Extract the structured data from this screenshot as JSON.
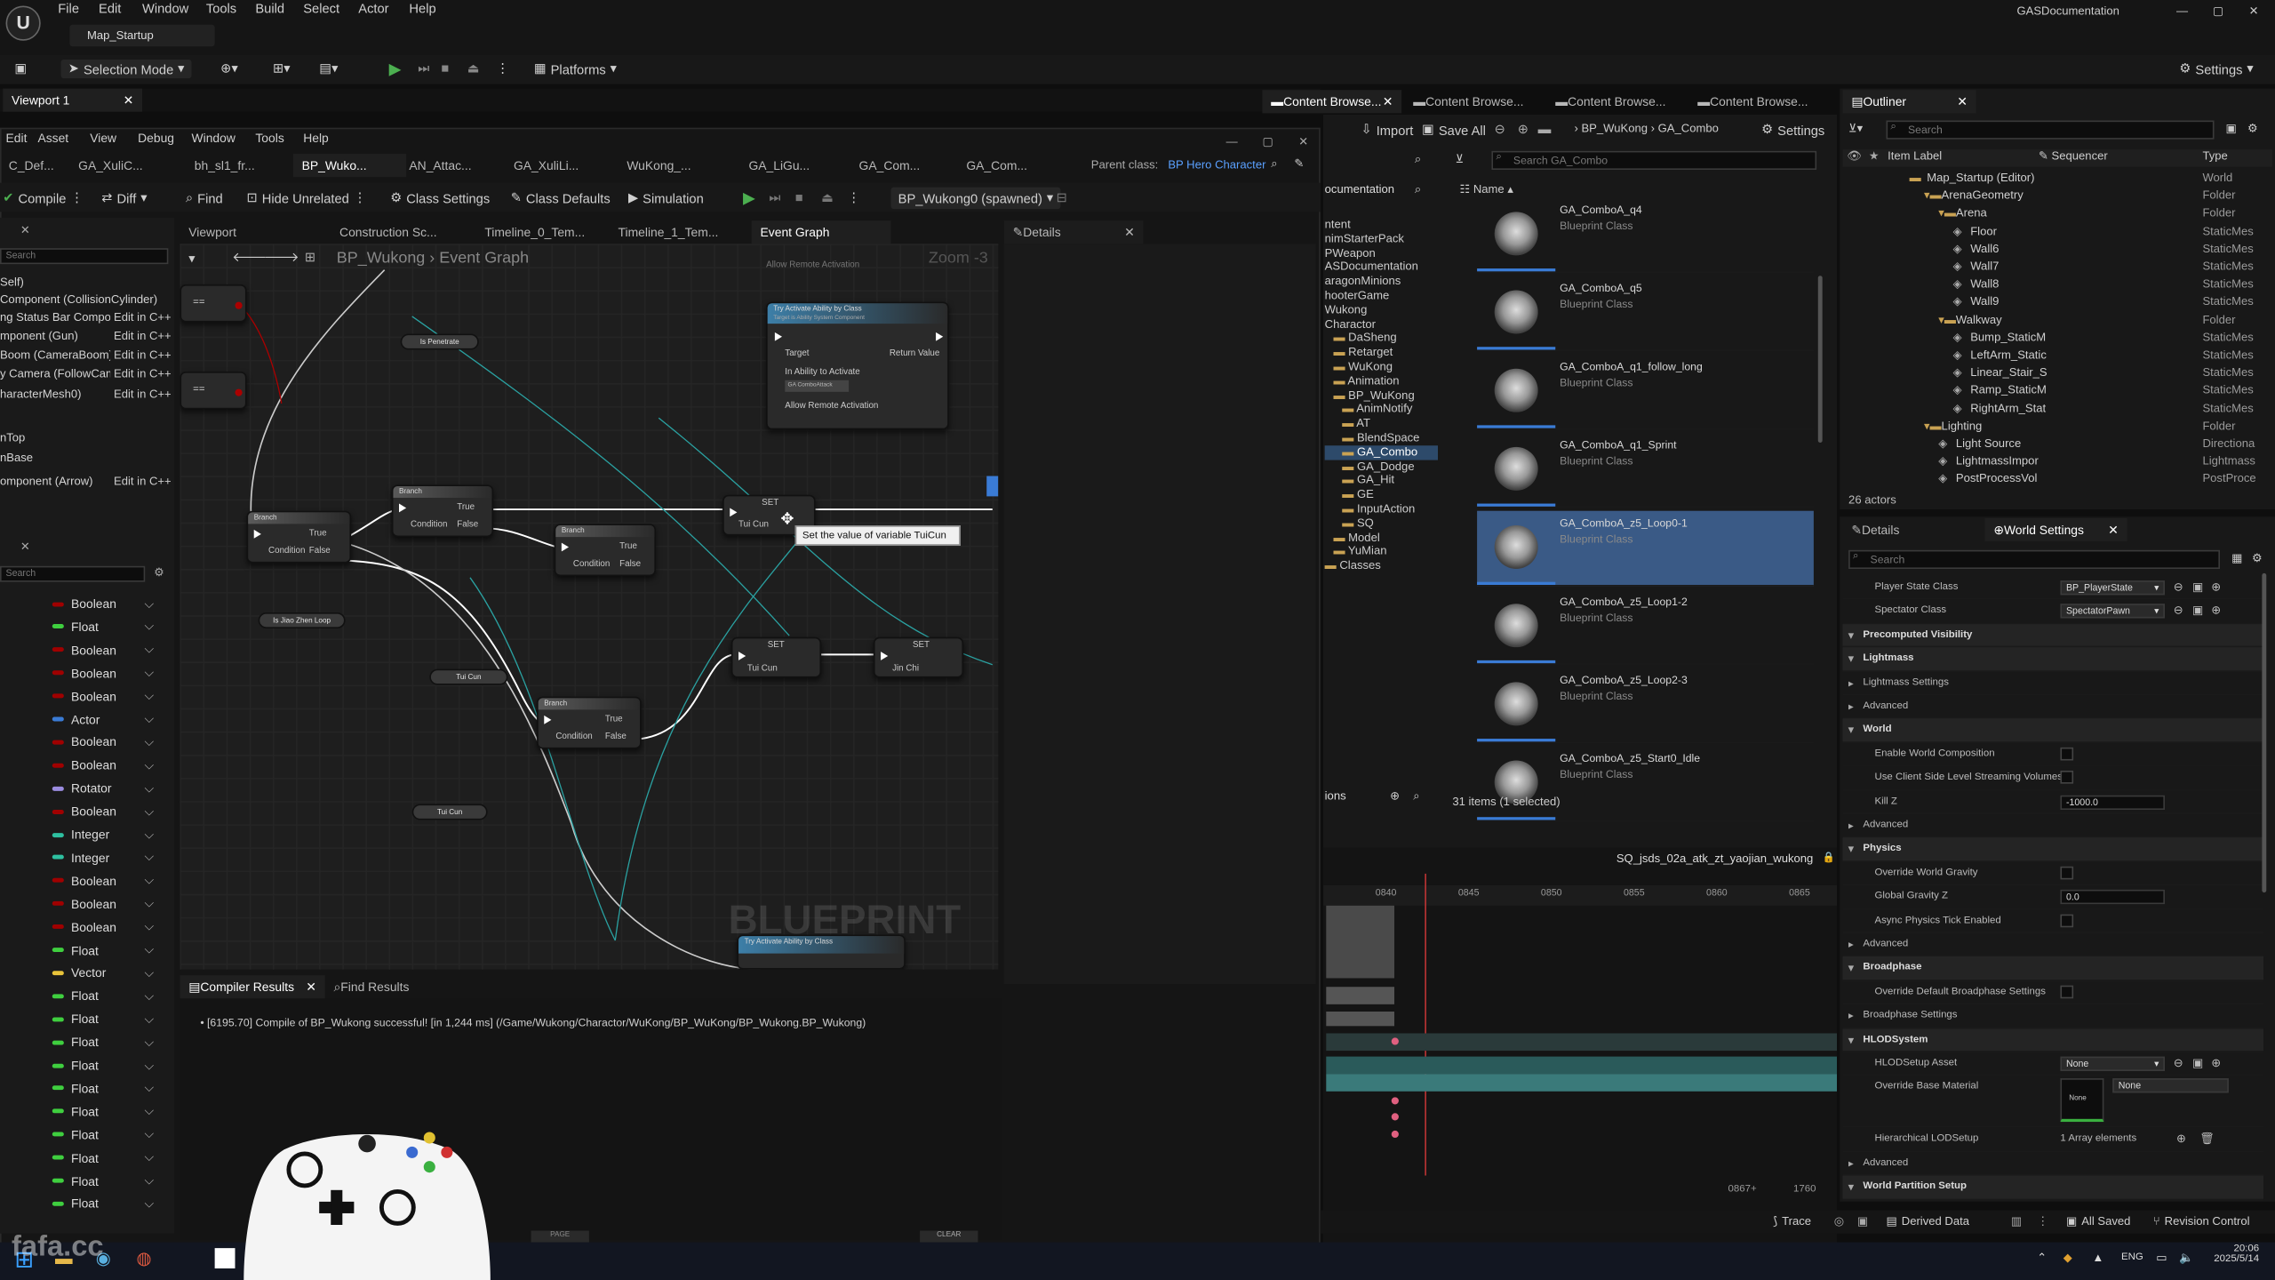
{
  "app": {
    "title": "GASDocumentation",
    "map_tab": "Map_Startup",
    "window_controls": [
      "—",
      "▢",
      "✕"
    ]
  },
  "menubar": [
    "File",
    "Edit",
    "Window",
    "Tools",
    "Build",
    "Select",
    "Actor",
    "Help"
  ],
  "main_toolbar": {
    "selection_mode": "Selection Mode",
    "platforms": "Platforms",
    "settings": "Settings"
  },
  "viewport_tab": "Viewport 1",
  "bp_editor": {
    "menubar": [
      "Edit",
      "Asset",
      "View",
      "Debug",
      "Window",
      "Tools",
      "Help"
    ],
    "asset_tabs": [
      "C_Def...",
      "GA_XuliC...",
      "bh_sl1_fr...",
      "BP_Wuko...",
      "AN_Attac...",
      "GA_XuliLi...",
      "WuKong_...",
      "GA_LiGu...",
      "GA_Com...",
      "GA_Com..."
    ],
    "parent_class_label": "Parent class:",
    "parent_class_value": "BP Hero Character",
    "toolbar": {
      "compile": "Compile",
      "diff": "Diff",
      "find": "Find",
      "hide_unrelated": "Hide Unrelated",
      "class_settings": "Class Settings",
      "class_defaults": "Class Defaults",
      "simulation": "Simulation",
      "debug_object": "BP_Wukong0 (spawned)"
    },
    "panel_tabs": [
      "Viewport",
      "Construction Sc...",
      "Timeline_0_Tem...",
      "Timeline_1_Tem...",
      "Event Graph"
    ],
    "details_tab": "Details",
    "breadcrumb": [
      "BP_Wukong",
      "Event Graph"
    ],
    "zoom": "Zoom -3",
    "watermark": "BLUEPRINT",
    "search_placeholder": "Search",
    "components": [
      "Self)",
      "Component (CollisionCylinder)",
      "ng Status Bar Component (UI)",
      "mponent (Gun)",
      "Boom (CameraBoom)",
      "y Camera (FollowCamera)",
      "haracterMesh0)",
      "nTop",
      "nBase",
      "omponent (Arrow)"
    ],
    "edit_in_cpp": "Edit in C++",
    "variables": [
      {
        "type": "Boolean",
        "color": "#a00000"
      },
      {
        "type": "Float",
        "color": "#3fcf3f"
      },
      {
        "type": "Boolean",
        "color": "#a00000"
      },
      {
        "type": "Boolean",
        "color": "#a00000"
      },
      {
        "type": "Boolean",
        "color": "#a00000"
      },
      {
        "type": "Actor",
        "color": "#3a7bd5"
      },
      {
        "type": "Boolean",
        "color": "#a00000"
      },
      {
        "type": "Boolean",
        "color": "#a00000"
      },
      {
        "type": "Rotator",
        "color": "#9b8ce0"
      },
      {
        "type": "Boolean",
        "color": "#a00000"
      },
      {
        "type": "Integer",
        "color": "#2ec0a0"
      },
      {
        "type": "Integer",
        "color": "#2ec0a0"
      },
      {
        "type": "Boolean",
        "color": "#a00000"
      },
      {
        "type": "Boolean",
        "color": "#a00000"
      },
      {
        "type": "Boolean",
        "color": "#a00000"
      },
      {
        "type": "Float",
        "color": "#3fcf3f"
      },
      {
        "type": "Vector",
        "color": "#e8c33a"
      },
      {
        "type": "Float",
        "color": "#3fcf3f"
      },
      {
        "type": "Float",
        "color": "#3fcf3f"
      },
      {
        "type": "Float",
        "color": "#3fcf3f"
      },
      {
        "type": "Float",
        "color": "#3fcf3f"
      },
      {
        "type": "Float",
        "color": "#3fcf3f"
      },
      {
        "type": "Float",
        "color": "#3fcf3f"
      },
      {
        "type": "Float",
        "color": "#3fcf3f"
      },
      {
        "type": "Float",
        "color": "#3fcf3f"
      },
      {
        "type": "Float",
        "color": "#3fcf3f"
      },
      {
        "type": "Float",
        "color": "#3fcf3f"
      }
    ],
    "graph": {
      "nodes": {
        "try_activate": "Try Activate Ability by Class",
        "target_comp": "Target is Ability System Component",
        "target": "Target",
        "return_value": "Return Value",
        "in_ability": "In Ability to Activate",
        "ability_val": "GA ComboAttack",
        "allow_remote": "Allow Remote Activation",
        "branch": "Branch",
        "true": "True",
        "false": "False",
        "condition": "Condition",
        "set": "SET",
        "is_penetrate": "Is Penetrate",
        "is_jiao": "Is Jiao Zhen Loop",
        "tuicun": "Tui Cun",
        "jinchi": "Jin Chi",
        "eq": "=="
      },
      "tooltip": "Set the value of variable TuiCun"
    },
    "compiler_tab": "Compiler Results",
    "find_results_tab": "Find Results",
    "compile_log": "[6195.70] Compile of BP_Wukong successful! [in 1,244 ms] (/Game/Wukong/Charactor/WuKong/BP_WuKong/BP_Wukong.BP_Wukong)",
    "clear_label": "CLEAR",
    "page_label": "PAGE"
  },
  "content_browser": {
    "tabs": [
      "Content Browse...",
      "Content Browse...",
      "Content Browse...",
      "Content Browse..."
    ],
    "toolbar": {
      "import": "Import",
      "save_all": "Save All",
      "settings": "Settings"
    },
    "path": [
      "BP_WuKong",
      "GA_Combo"
    ],
    "search_placeholder": "Search GA_Combo",
    "name_col": "Name",
    "tree_header": "ocumentation",
    "tree": [
      "ntent",
      "nimStarterPack",
      "PWeapon",
      "ASDocumentation",
      "aragonMinions",
      "hooterGame",
      "Wukong",
      "Charactor",
      "DaSheng",
      "Retarget",
      "WuKong",
      "Animation",
      "BP_WuKong",
      "AnimNotify",
      "AT",
      "BlendSpace",
      "GA_Combo",
      "GA_Dodge",
      "GA_Hit",
      "GE",
      "InputAction",
      "SQ",
      "Model",
      "YuMian",
      "Classes"
    ],
    "assets": [
      {
        "name": "GA_ComboA_q4",
        "cls": "Blueprint Class"
      },
      {
        "name": "GA_ComboA_q5",
        "cls": "Blueprint Class"
      },
      {
        "name": "GA_ComboA_q1_follow_long",
        "cls": "Blueprint Class"
      },
      {
        "name": "GA_ComboA_q1_Sprint",
        "cls": "Blueprint Class"
      },
      {
        "name": "GA_ComboA_z5_Loop0-1",
        "cls": "Blueprint Class"
      },
      {
        "name": "GA_ComboA_z5_Loop1-2",
        "cls": "Blueprint Class"
      },
      {
        "name": "GA_ComboA_z5_Loop2-3",
        "cls": "Blueprint Class"
      },
      {
        "name": "GA_ComboA_z5_Start0_Idle",
        "cls": "Blueprint Class"
      }
    ],
    "status": "31 items (1 selected)",
    "collections": "ions"
  },
  "sequencer": {
    "title": "SQ_jsds_02a_atk_zt_yaojian_wukong",
    "ticks": [
      "0840",
      "0845",
      "0850",
      "0855",
      "0860",
      "0865"
    ],
    "frame": "0867+",
    "end": "1760"
  },
  "outliner": {
    "tab": "Outliner",
    "search_placeholder": "Search",
    "col_label": "Item Label",
    "col_seq": "Sequencer",
    "col_type": "Type",
    "rows": [
      {
        "l": "Map_Startup (Editor)",
        "t": "World",
        "d": 0
      },
      {
        "l": "ArenaGeometry",
        "t": "Folder",
        "d": 1
      },
      {
        "l": "Arena",
        "t": "Folder",
        "d": 2
      },
      {
        "l": "Floor",
        "t": "StaticMes",
        "d": 3
      },
      {
        "l": "Wall6",
        "t": "StaticMes",
        "d": 3
      },
      {
        "l": "Wall7",
        "t": "StaticMes",
        "d": 3
      },
      {
        "l": "Wall8",
        "t": "StaticMes",
        "d": 3
      },
      {
        "l": "Wall9",
        "t": "StaticMes",
        "d": 3
      },
      {
        "l": "Walkway",
        "t": "Folder",
        "d": 2
      },
      {
        "l": "Bump_StaticM",
        "t": "StaticMes",
        "d": 3
      },
      {
        "l": "LeftArm_Static",
        "t": "StaticMes",
        "d": 3
      },
      {
        "l": "Linear_Stair_S",
        "t": "StaticMes",
        "d": 3
      },
      {
        "l": "Ramp_StaticM",
        "t": "StaticMes",
        "d": 3
      },
      {
        "l": "RightArm_Stat",
        "t": "StaticMes",
        "d": 3
      },
      {
        "l": "Lighting",
        "t": "Folder",
        "d": 1
      },
      {
        "l": "Light Source",
        "t": "Directiona",
        "d": 2
      },
      {
        "l": "LightmassImpor",
        "t": "Lightmass",
        "d": 2
      },
      {
        "l": "PostProcessVol",
        "t": "PostProce",
        "d": 2
      }
    ],
    "count": "26 actors"
  },
  "details": {
    "tab_details": "Details",
    "tab_world": "World Settings",
    "search_placeholder": "Search",
    "rows": [
      {
        "k": "Player State Class",
        "v": "BP_PlayerState",
        "kind": "combo"
      },
      {
        "k": "Spectator Class",
        "v": "SpectatorPawn",
        "kind": "combo"
      },
      {
        "k": "Precomputed Visibility",
        "kind": "section"
      },
      {
        "k": "Lightmass",
        "kind": "section"
      },
      {
        "k": "Lightmass Settings",
        "kind": "sub"
      },
      {
        "k": "Advanced",
        "kind": "sub"
      },
      {
        "k": "World",
        "kind": "section"
      },
      {
        "k": "Enable World Composition",
        "kind": "check"
      },
      {
        "k": "Use Client Side Level Streaming Volumes",
        "kind": "check"
      },
      {
        "k": "Kill Z",
        "v": "-1000.0",
        "kind": "input"
      },
      {
        "k": "Advanced",
        "kind": "sub"
      },
      {
        "k": "Physics",
        "kind": "section"
      },
      {
        "k": "Override World Gravity",
        "kind": "check"
      },
      {
        "k": "Global Gravity Z",
        "v": "0.0",
        "kind": "input"
      },
      {
        "k": "Async Physics Tick Enabled",
        "kind": "check"
      },
      {
        "k": "Advanced",
        "kind": "sub"
      },
      {
        "k": "Broadphase",
        "kind": "section"
      },
      {
        "k": "Override Default Broadphase Settings",
        "kind": "check"
      },
      {
        "k": "Broadphase Settings",
        "kind": "sub"
      },
      {
        "k": "HLODSystem",
        "kind": "section"
      },
      {
        "k": "HLODSetup Asset",
        "v": "None",
        "kind": "combo"
      },
      {
        "k": "Override Base Material",
        "v": "None",
        "kind": "mat"
      },
      {
        "k": "Hierarchical LODSetup",
        "v": "1 Array elements",
        "kind": "arr"
      },
      {
        "k": "Advanced",
        "kind": "sub"
      },
      {
        "k": "World Partition Setup",
        "kind": "section"
      }
    ]
  },
  "statusbar": {
    "trace": "Trace",
    "derived": "Derived Data",
    "all_saved": "All Saved",
    "revision": "Revision Control",
    "lang": "ENG",
    "time": "20:06",
    "date": "2025/5/14"
  },
  "watermark": "fafa.cc"
}
